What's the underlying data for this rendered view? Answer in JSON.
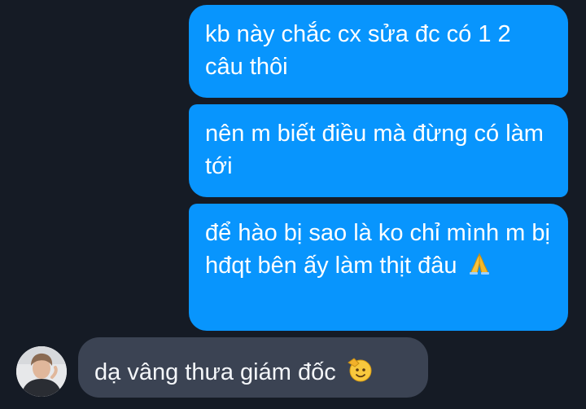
{
  "messages": [
    {
      "id": "msg1",
      "direction": "outgoing",
      "text": "kb này chắc cx sửa đc có 1 2 câu thôi"
    },
    {
      "id": "msg2",
      "direction": "outgoing",
      "text": "nên m biết điều mà đừng có làm tới"
    },
    {
      "id": "msg3",
      "direction": "outgoing",
      "text": "để hào bị sao là ko chỉ mình m bị hđqt bên ấy làm thịt đâu",
      "emoji": "folded-hands-icon"
    },
    {
      "id": "msg4",
      "direction": "incoming",
      "text": "dạ vâng thưa giám đốc",
      "emoji": "saluting-face-icon"
    }
  ],
  "colors": {
    "background": "#151b25",
    "outgoing_bubble": "#0895fd",
    "incoming_bubble": "#3b4353",
    "text": "#ffffff"
  }
}
